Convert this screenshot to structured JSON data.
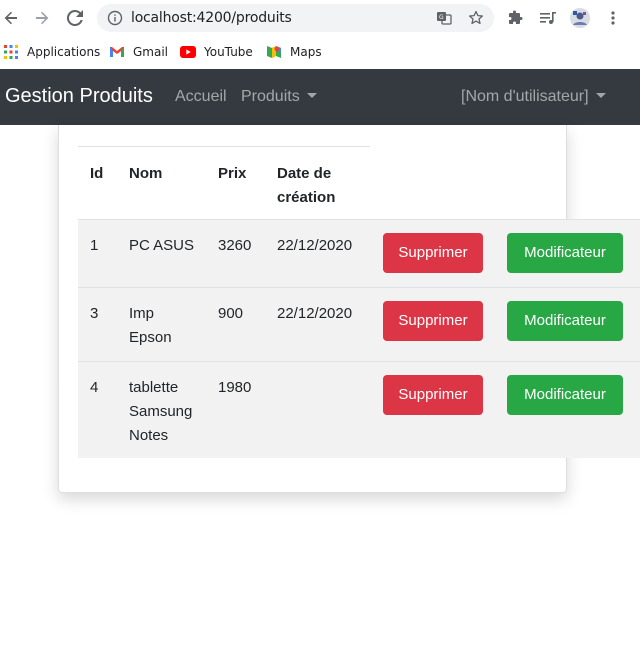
{
  "browser": {
    "url": "localhost:4200/produits"
  },
  "bookmarks": [
    {
      "label": "Applications",
      "icon": "apps-grid-icon"
    },
    {
      "label": "Gmail",
      "icon": "gmail-icon"
    },
    {
      "label": "YouTube",
      "icon": "youtube-icon"
    },
    {
      "label": "Maps",
      "icon": "maps-icon"
    }
  ],
  "navbar": {
    "brand": "Gestion Produits",
    "home": "Accueil",
    "products": "Produits",
    "user": "[Nom d'utilisateur]"
  },
  "table": {
    "headers": {
      "id": "Id",
      "name": "Nom",
      "price": "Prix",
      "date_line1": "Date de",
      "date_line2": "création"
    },
    "rows": [
      {
        "id": "1",
        "name_lines": [
          "PC ASUS"
        ],
        "price": "3260",
        "date": "22/12/2020"
      },
      {
        "id": "3",
        "name_lines": [
          "Imp",
          "Epson"
        ],
        "price": "900",
        "date": "22/12/2020"
      },
      {
        "id": "4",
        "name_lines": [
          "tablette",
          "Samsung",
          "Notes"
        ],
        "price": "1980",
        "date": ""
      }
    ],
    "delete_label": "Supprimer",
    "edit_label": "Modificateur"
  },
  "colors": {
    "navbar": "#343a40",
    "danger": "#dc3545",
    "success": "#28a745"
  }
}
